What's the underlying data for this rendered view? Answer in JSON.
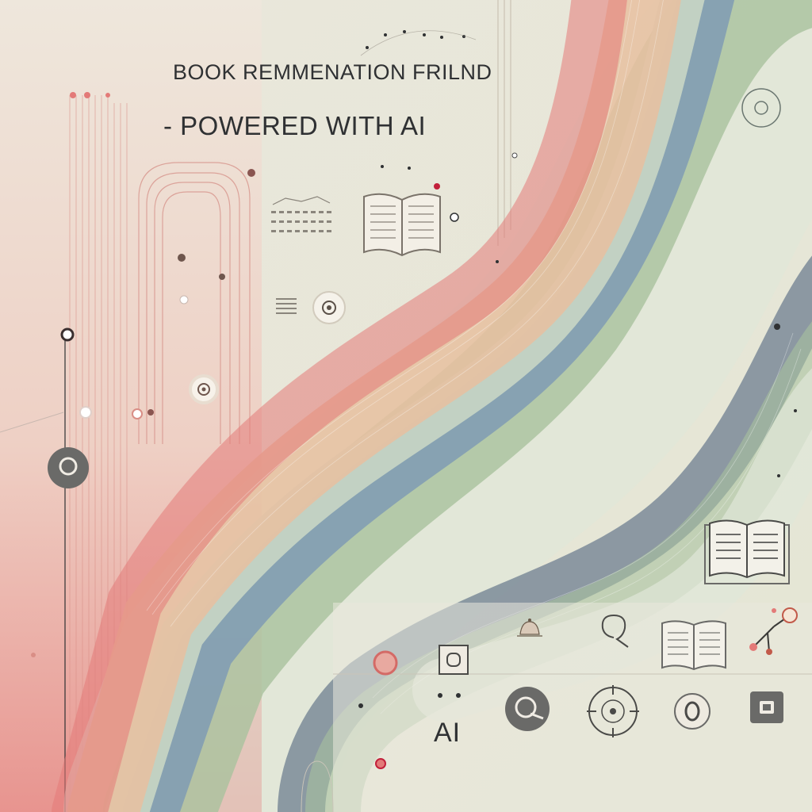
{
  "header": {
    "title": "BOOK REMMENATION FRILND",
    "subtitle": "- POWERED WITH AI"
  },
  "bottom_label": "AI",
  "icons": [
    "book-icon",
    "text-lines-icon",
    "target-circle-icon",
    "location-pin-icon",
    "chat-bubble-icon",
    "node-network-icon",
    "bell-icon",
    "compass-icon",
    "checkbox-icon"
  ],
  "colors": {
    "background": "#ece8dc",
    "wave_red": "#e37a78",
    "wave_peach": "#e8bfa0",
    "wave_green": "#a9c29e",
    "wave_blue": "#7f9bb4",
    "wave_slate": "#5c6f86",
    "ink": "#2f3133"
  }
}
